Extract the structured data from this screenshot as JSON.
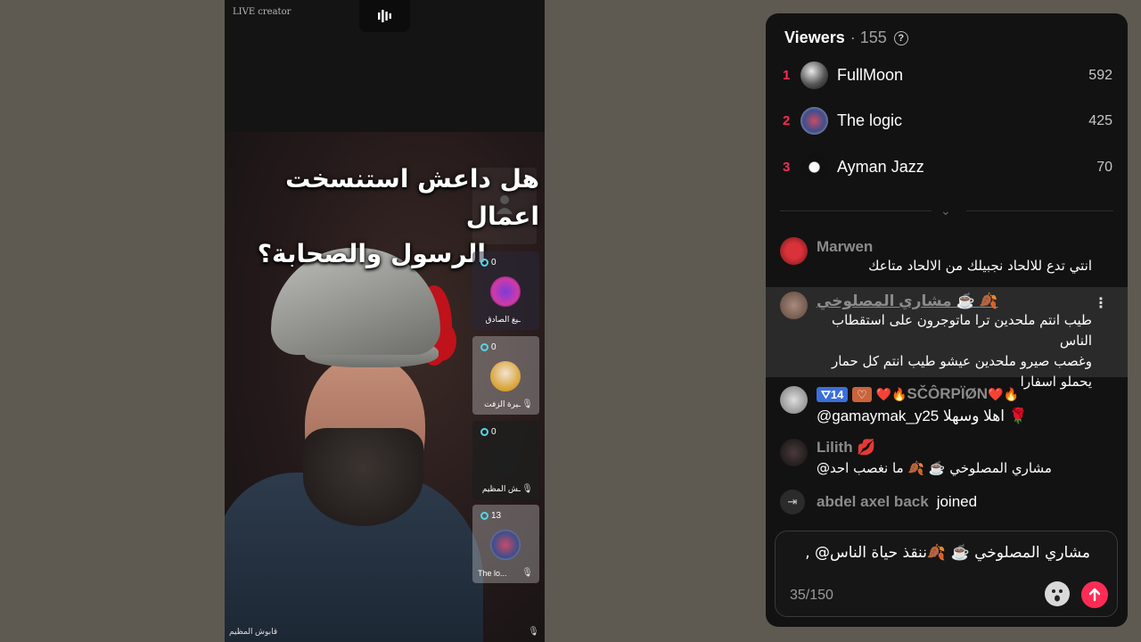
{
  "video": {
    "live_label": "LIVE creator",
    "headline_line1": "هل داعش استنسخت اعمال",
    "headline_line2": "الرسول والصحابة؟",
    "host_name": "قابوش المظيم",
    "guests": [
      {
        "count": "0",
        "name": "ـيغ الصادق",
        "muted": false
      },
      {
        "count": "0",
        "name": "ـيرة الزفت",
        "muted": true
      },
      {
        "count": "0",
        "name": "ـش المظيم",
        "muted": true
      },
      {
        "count": "13",
        "name": "The lo...",
        "muted": true
      }
    ]
  },
  "viewers": {
    "title": "Viewers",
    "count": "· 155",
    "help_icon": "?",
    "ranking": [
      {
        "rank": "1",
        "name": "FullMoon",
        "score": "592"
      },
      {
        "rank": "2",
        "name": "The logic",
        "score": "425"
      },
      {
        "rank": "3",
        "name": "Ayman Jazz",
        "score": "70"
      }
    ],
    "collapse_icon": "⌄"
  },
  "chat": {
    "messages": [
      {
        "user": "Marwen",
        "text": "انتي تدع للالحاد نجبيلك من الالحاد متاعك"
      },
      {
        "user": "مشاري المصلوخي ☕️ 🍂",
        "text_line1": "طيب انتم ملحدين ترا ماتوجرون على استقطاب الناس",
        "text_line2": "وغصب صيرو ملحدين عيشو طيب انتم كل حمار",
        "text_line3": "يحملو اسفارا",
        "menu_icon": "⋮"
      },
      {
        "user": "SČÔRPÏØN",
        "level": "14",
        "fan_badge": "♡",
        "user_prefix": "❤️🔥",
        "user_suffix": "❤️🔥",
        "text": "@gamaymak_y25 اهلا وسهلا 🌹"
      },
      {
        "user": "Lilith 💋",
        "text": "مشاري المصلوخي ☕️ 🍂 ما نغصب احد@"
      }
    ],
    "join": {
      "icon": "⇥",
      "user": "abdel axel back",
      "action": "joined"
    }
  },
  "composer": {
    "text": "مشاري المصلوخي ☕️ 🍂ننقذ حياة الناس@ ,",
    "counter": "35/150"
  },
  "colors": {
    "accent": "#fe2c55",
    "panel_bg": "#121212",
    "page_bg": "#5e5a51"
  }
}
